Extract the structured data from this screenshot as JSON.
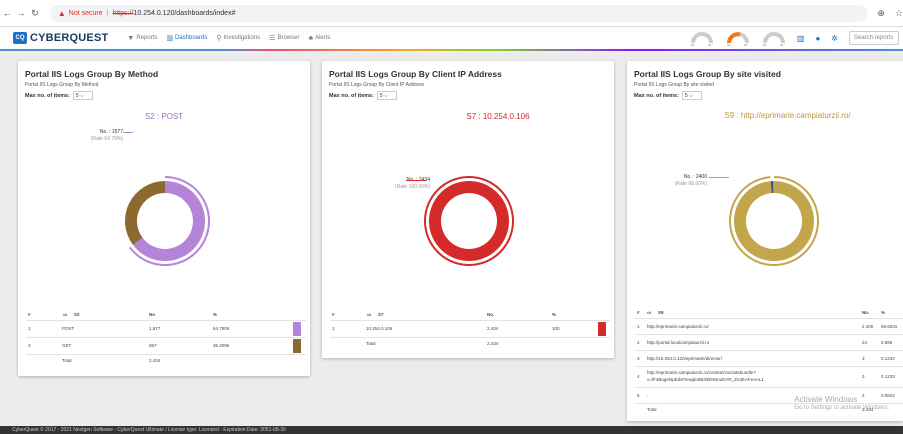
{
  "browser": {
    "not_secure": "Not secure",
    "scheme": "https://",
    "host": "10.254.0.120/dashboards/index#"
  },
  "brand": {
    "badge": "CQ",
    "name": "CYBERQUEST"
  },
  "nav": {
    "reports": "Reports",
    "dashboards": "Dashboards",
    "investigations": "Investigations",
    "browser": "Browser",
    "alerts": "Alerts"
  },
  "search": {
    "placeholder": "Search reports"
  },
  "gauge_tick": "00",
  "common": {
    "max_label": "Max no. of items:",
    "max_value": "5"
  },
  "panels": [
    {
      "title": "Portal IIS Logs Group By Method",
      "subtitle": "Portal IIS Logs Group By Method",
      "chart_title": "S2 : POST",
      "label_no": "No. : 1577",
      "label_rate": "(Rate 64.79%)",
      "columns": {
        "hash": "#",
        "name": "S2",
        "no": "No",
        "pct": "%"
      },
      "rows": [
        {
          "i": "1",
          "name": "POST",
          "no": "1,577",
          "pct": "64.7905"
        },
        {
          "i": "2",
          "name": "GET",
          "no": "857",
          "pct": "35.2095"
        }
      ],
      "total_label": "Total",
      "total_no": "2,434"
    },
    {
      "title": "Portal IIS Logs Group By Client IP Address",
      "subtitle": "Portal IIS Logs Group By Client IP Address",
      "chart_title": "S7 : 10.254.0.106",
      "label_no": "No. : 2434",
      "label_rate": "(Rate 100.00%)",
      "columns": {
        "hash": "#",
        "name": "S7",
        "no": "No.",
        "pct": "%"
      },
      "rows": [
        {
          "i": "1",
          "name": "10.254.0.106",
          "no": "2,434",
          "pct": "100"
        }
      ],
      "total_label": "Total",
      "total_no": "2,434"
    },
    {
      "title": "Portal IIS Logs Group By site visited",
      "subtitle": "Portal IIS Logs Group By site visited",
      "chart_title": "S9 : http://eprimarie.campiaturzii.ro/",
      "label_no": "No. : 2400",
      "label_rate": "(Rate 98.60%)",
      "columns": {
        "hash": "#",
        "name": "S9",
        "no": "No.",
        "pct": "%"
      },
      "rows": [
        {
          "i": "1",
          "name": "http://eprimarie.campiaturzii.ro/",
          "no": "2,400",
          "pct": "98.6031"
        },
        {
          "i": "2",
          "name": "http://portal.localcampiaturzii.ro",
          "no": "24",
          "pct": "0.986"
        },
        {
          "i": "3",
          "name": "http://10.254.0.120/eprimarie/director/",
          "no": "3",
          "pct": "0.1234"
        },
        {
          "i": "4",
          "name": "http://eprimarie.campiaturzii.ro/content/css/sitebundle?",
          "name2": "v=fF4BogeNpEdsFiewjdo6B33EtNmuDAR_Zn3EAFeAnL1",
          "no": "3",
          "pct": "0.1233"
        },
        {
          "i": "5",
          "name": "-",
          "no": "2",
          "pct": "0.0822"
        }
      ],
      "total_label": "Total",
      "total_no": "2,434"
    }
  ],
  "chart_data": [
    {
      "type": "pie",
      "title": "S2 : POST",
      "categories": [
        "POST",
        "GET"
      ],
      "values": [
        1577,
        857
      ],
      "colors": [
        "#b384d8",
        "#8c6a2f"
      ]
    },
    {
      "type": "pie",
      "title": "S7 : 10.254.0.106",
      "categories": [
        "10.254.0.106"
      ],
      "values": [
        2434
      ],
      "colors": [
        "#d42a2a"
      ]
    },
    {
      "type": "pie",
      "title": "S9 : http://eprimarie.campiaturzii.ro/",
      "categories": [
        "http://eprimarie.campiaturzii.ro/",
        "http://portal.localcampiaturzii.ro",
        "http://10.254.0.120/eprimarie/director/",
        "http://eprimarie.campiaturzii.ro/content/css/sitebundle?v=fF4BogeNpEdsFiewjdo6B33EtNmuDAR_Zn3EAFeAnL1",
        "-"
      ],
      "values": [
        2400,
        24,
        3,
        3,
        2
      ],
      "colors": [
        "#c3a64c",
        "#2a5a8a",
        "#4a90d9",
        "#7ed321",
        "#e94e77"
      ]
    }
  ],
  "windows": {
    "line1": "Activate Windows",
    "line2": "Go to Settings to activate Windows."
  },
  "footer": {
    "text": "CyberQuest © 2017 - 2021 Nextgen Software - CyberQuest Ultimate / License type: Licensed - Expiration Date: 2051-08-30"
  }
}
